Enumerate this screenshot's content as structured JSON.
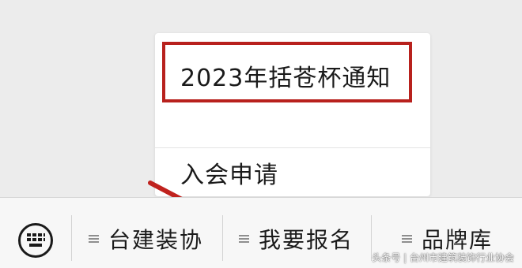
{
  "popup_menu": {
    "items": [
      {
        "label": "2023年括苍杯通知"
      },
      {
        "label": "入会申请"
      }
    ]
  },
  "bottom_menu": {
    "keyboard_icon": "keyboard-icon",
    "tabs": [
      {
        "label": "台建装协",
        "icon": "menu-icon"
      },
      {
        "label": "我要报名",
        "icon": "menu-icon"
      },
      {
        "label": "品牌库",
        "icon": "menu-icon"
      }
    ]
  },
  "annotations": {
    "highlight_color": "#b8211d",
    "arrow_color": "#c0221e"
  },
  "watermark": {
    "text": "头条号 | 台州市建筑装饰行业协会"
  }
}
